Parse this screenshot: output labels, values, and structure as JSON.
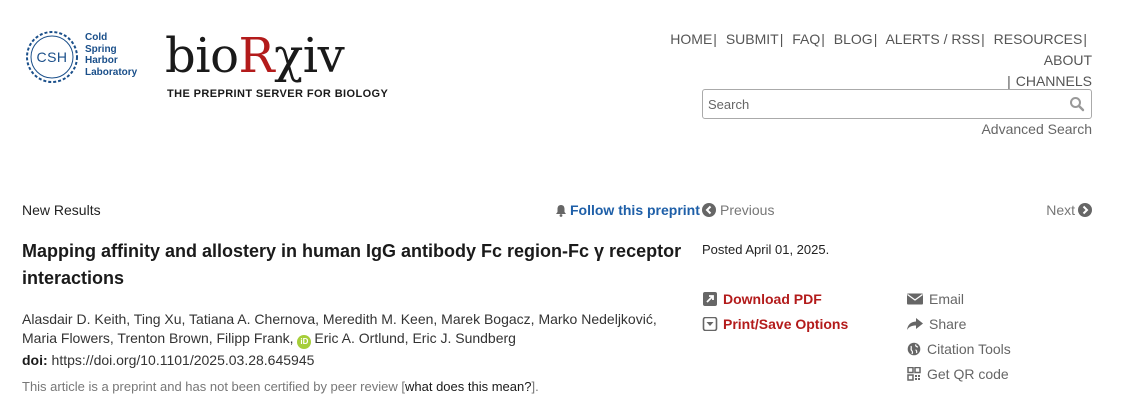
{
  "csh": {
    "ring": "CSH",
    "name": [
      "Cold",
      "Spring",
      "Harbor",
      "Laboratory"
    ]
  },
  "brand": {
    "name_pre": "bio",
    "name_r": "R",
    "name_post": "χiv",
    "tagline": "THE PREPRINT SERVER FOR BIOLOGY"
  },
  "nav": {
    "items": [
      "HOME",
      "SUBMIT",
      "FAQ",
      "BLOG",
      "ALERTS / RSS",
      "RESOURCES",
      "ABOUT",
      "CHANNELS"
    ],
    "separator": "|"
  },
  "search": {
    "placeholder": "Search",
    "advanced": "Advanced Search"
  },
  "article": {
    "type": "New Results",
    "follow": "Follow this preprint",
    "title": "Mapping affinity and allostery in human IgG antibody Fc region-Fc γ receptor interactions",
    "authors_line1": "Alasdair D. Keith, Ting Xu, Tatiana A. Chernova, Meredith M. Keen, Marek Bogacz, Marko Nedeljković,",
    "authors_line2_a": "Maria Flowers, Trenton Brown, Filipp Frank,",
    "orcid": "iD",
    "authors_line2_b": "Eric A. Ortlund, Eric J. Sundberg",
    "doi_label": "doi:",
    "doi": "https://doi.org/10.1101/2025.03.28.645945",
    "disclaimer": "This article is a preprint and has not been certified by peer review",
    "disclaimer_link": "what does this mean?",
    "disclaimer_open": "[",
    "disclaimer_close": "]."
  },
  "pager": {
    "previous": "Previous",
    "next": "Next"
  },
  "posted": "Posted April 01, 2025.",
  "actions": {
    "download": "Download PDF",
    "print": "Print/Save Options",
    "email": "Email",
    "share": "Share",
    "citation": "Citation Tools",
    "qr": "Get QR code"
  },
  "colors": {
    "brand_red": "#b31b1b",
    "link_blue": "#1e5fa8",
    "orcid_green": "#a6ce39",
    "csh_blue": "#1a4f8a"
  }
}
